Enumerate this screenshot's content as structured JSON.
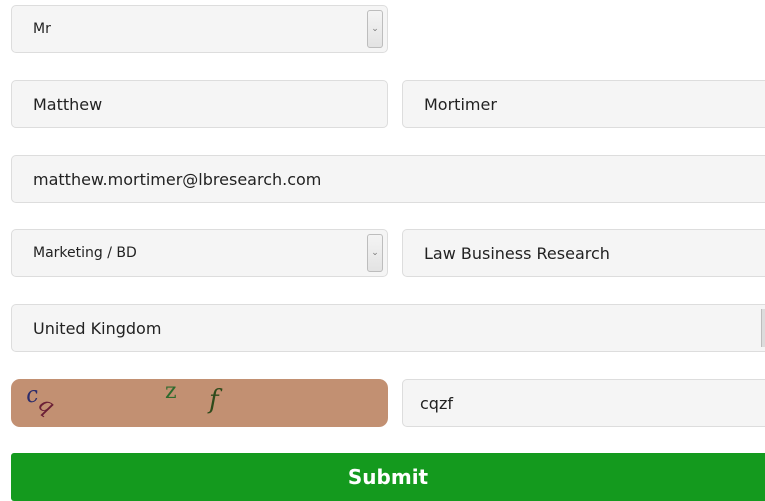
{
  "form": {
    "title_select": {
      "value": "Mr"
    },
    "first_name": {
      "value": "Matthew"
    },
    "last_name": {
      "value": "Mortimer"
    },
    "email": {
      "value": "matthew.mortimer@lbresearch.com"
    },
    "job_function_select": {
      "value": "Marketing / BD"
    },
    "company": {
      "value": "Law Business Research"
    },
    "country": {
      "value": "United Kingdom"
    },
    "captcha": {
      "chars": [
        "c",
        "q",
        "z",
        "f"
      ],
      "background_color": "#c29072",
      "char_colors": [
        "#2c2c6b",
        "#6b2036",
        "#2d6a2d",
        "#2e4a1b"
      ]
    },
    "captcha_input": {
      "value": "cqzf"
    },
    "submit_label": "Submit",
    "submit_color": "#149a1e",
    "dropdown_icon": "chevron-down-icon"
  }
}
